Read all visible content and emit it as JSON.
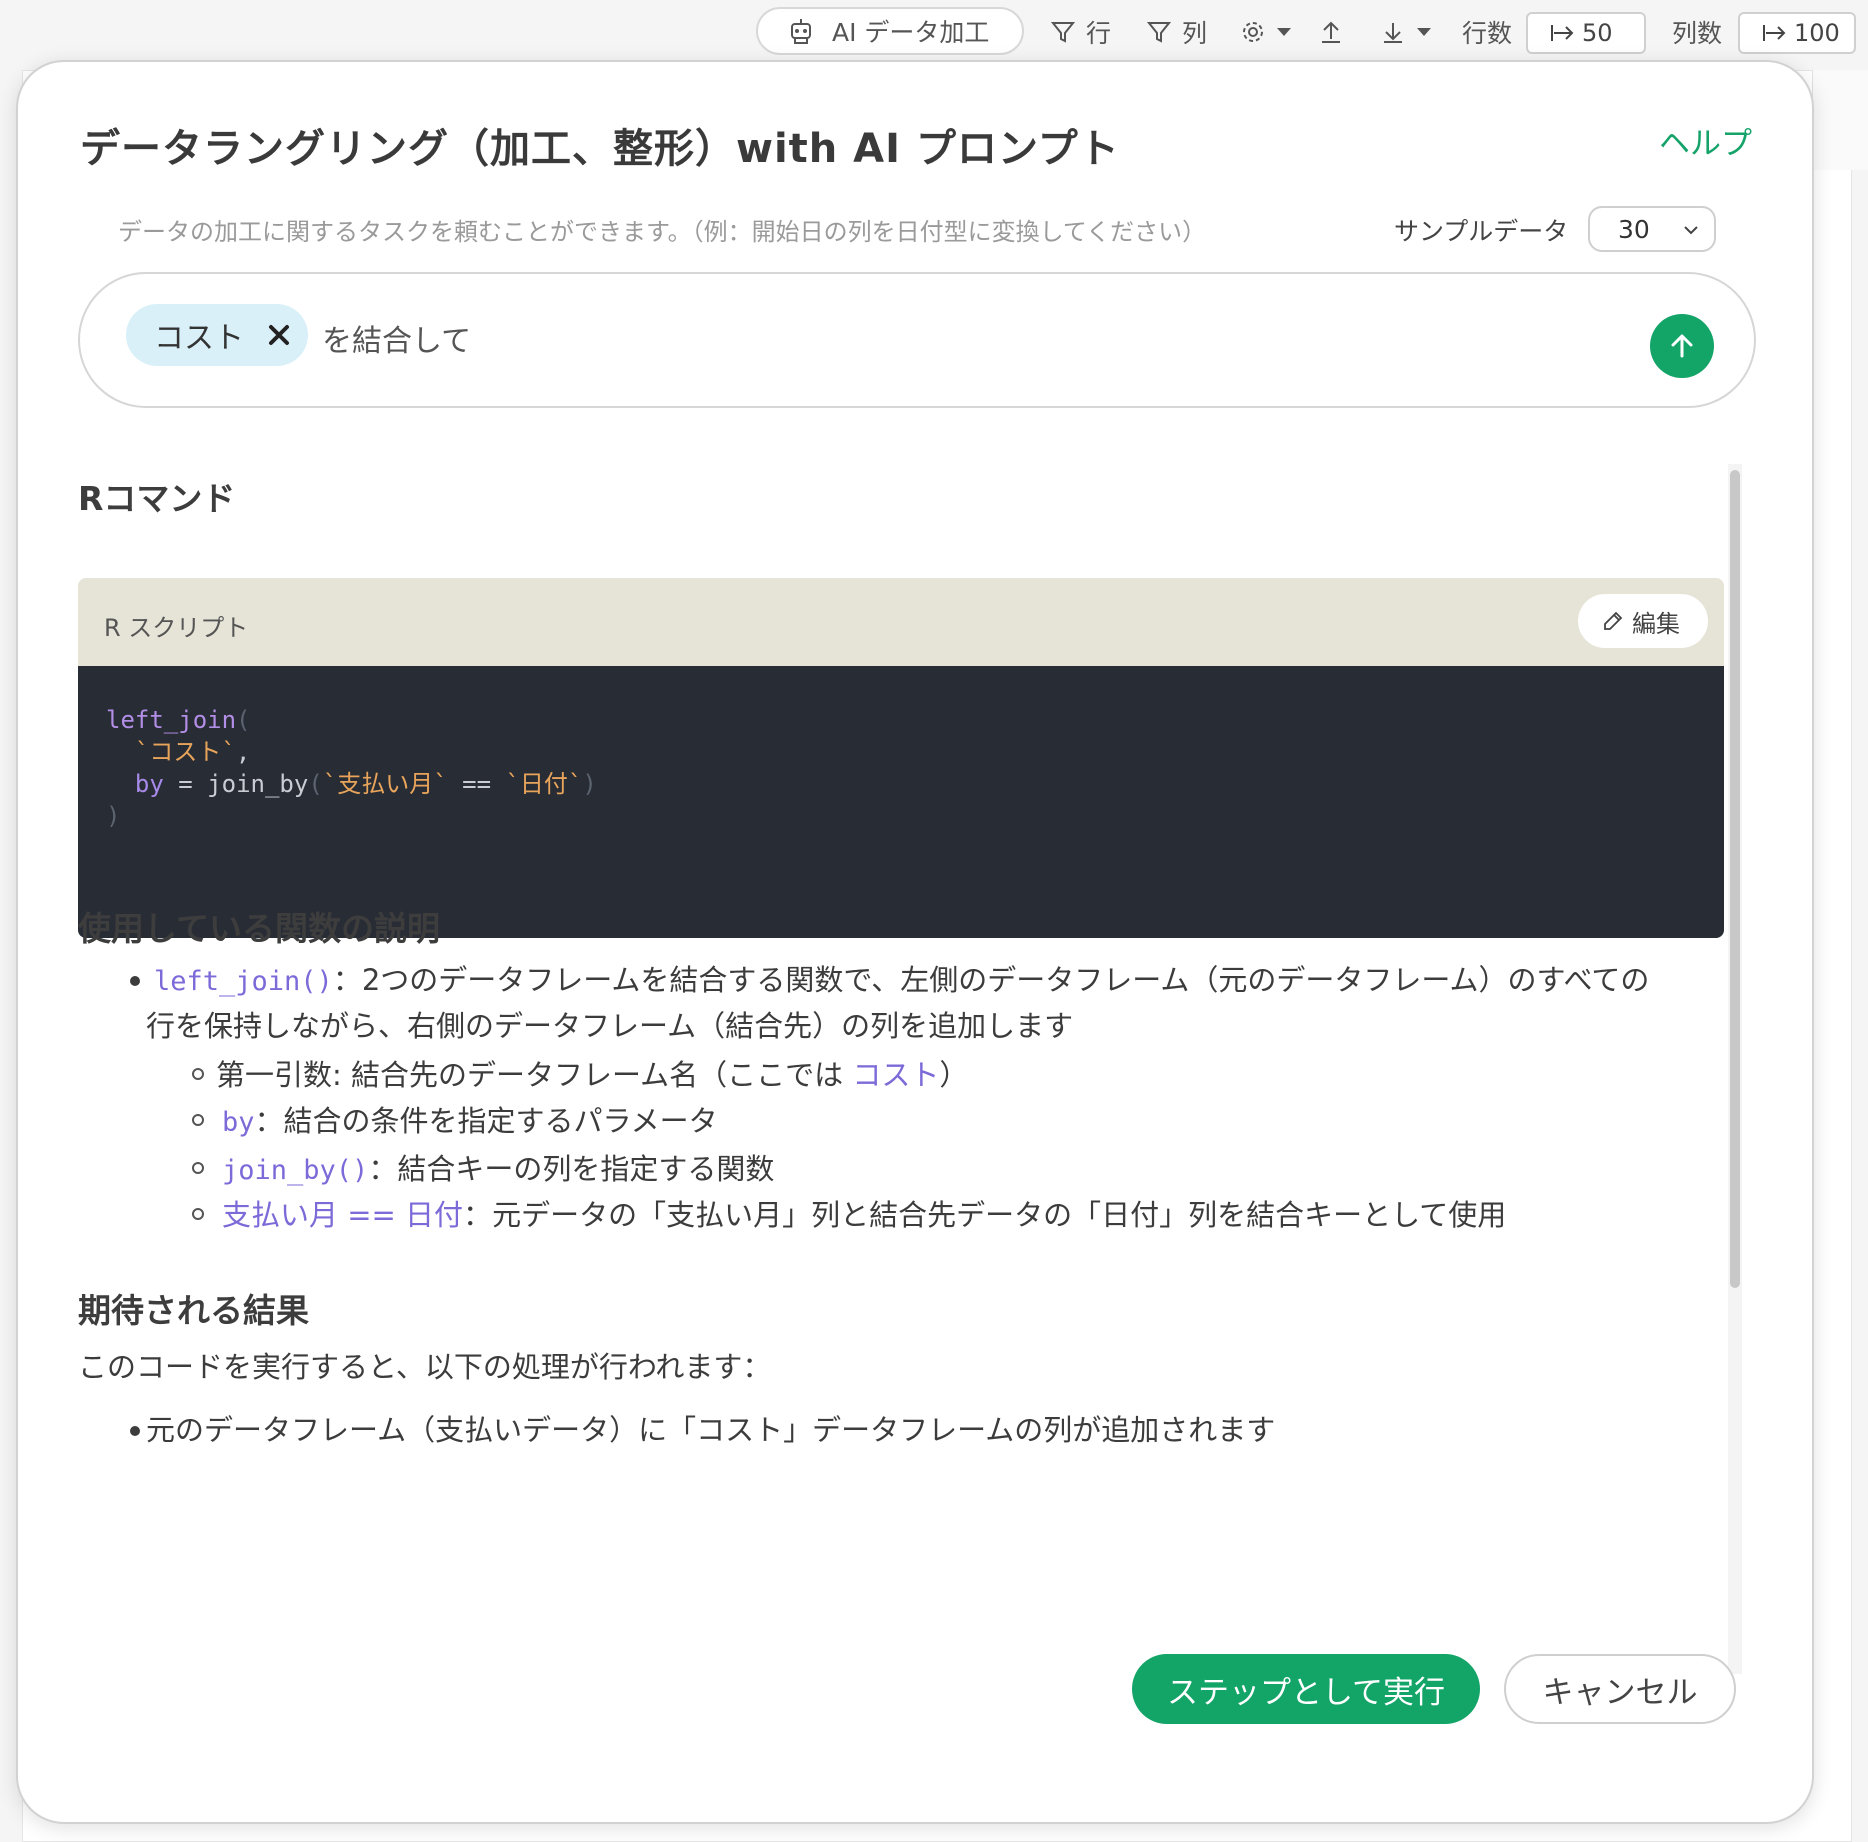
{
  "toolbar": {
    "ai_button_label": "AI データ加工",
    "row_filter_label": "行",
    "col_filter_label": "列",
    "row_count_label": "行数",
    "row_count_value": "50",
    "col_count_label": "列数",
    "col_count_value": "100"
  },
  "modal": {
    "title": "データラングリング（加工、整形）with AI プロンプト",
    "help_label": "ヘルプ",
    "hint": "データの加工に関するタスクを頼むことができます。（例：開始日の列を日付型に変換してください）",
    "sample_label": "サンプルデータ",
    "sample_value": "30",
    "prompt": {
      "chip_label": "コスト",
      "text": "を結合して"
    },
    "rcommand_heading": "Rコマンド",
    "script": {
      "label": "R スクリプト",
      "edit_label": "編集"
    },
    "functions_heading": "使用している関数の説明",
    "functions": {
      "left_join_code": "left_join()",
      "left_join_desc_1": "2つのデータフレームを結合する関数で、左側のデータフレーム（元のデータフレーム）のすべての",
      "left_join_desc_2": "行を保持しながら、右側のデータフレーム（結合先）の列を追加します",
      "arg1_text": "第一引数: 結合先のデータフレーム名（ここでは ",
      "arg1_code": "コスト",
      "arg1_close": "）",
      "by_code": "by",
      "by_desc": "結合の条件を指定するパラメータ",
      "joinby_code": "join_by()",
      "joinby_desc": "結合キーの列を指定する関数",
      "key_code": "支払い月 == 日付",
      "key_desc": "元データの「支払い月」列と結合先データの「日付」列を結合キーとして使用"
    },
    "expected_heading": "期待される結果",
    "expected_intro": "このコードを実行すると、以下の処理が行われます：",
    "expected_items": [
      "元のデータフレーム（支払いデータ）に「コスト」データフレームの列が追加されます"
    ],
    "run_label": "ステップとして実行",
    "cancel_label": "キャンセル"
  },
  "colors": {
    "accent": "#13a468",
    "code_bg": "#282c35",
    "chip_bg": "#d9f0f9"
  }
}
